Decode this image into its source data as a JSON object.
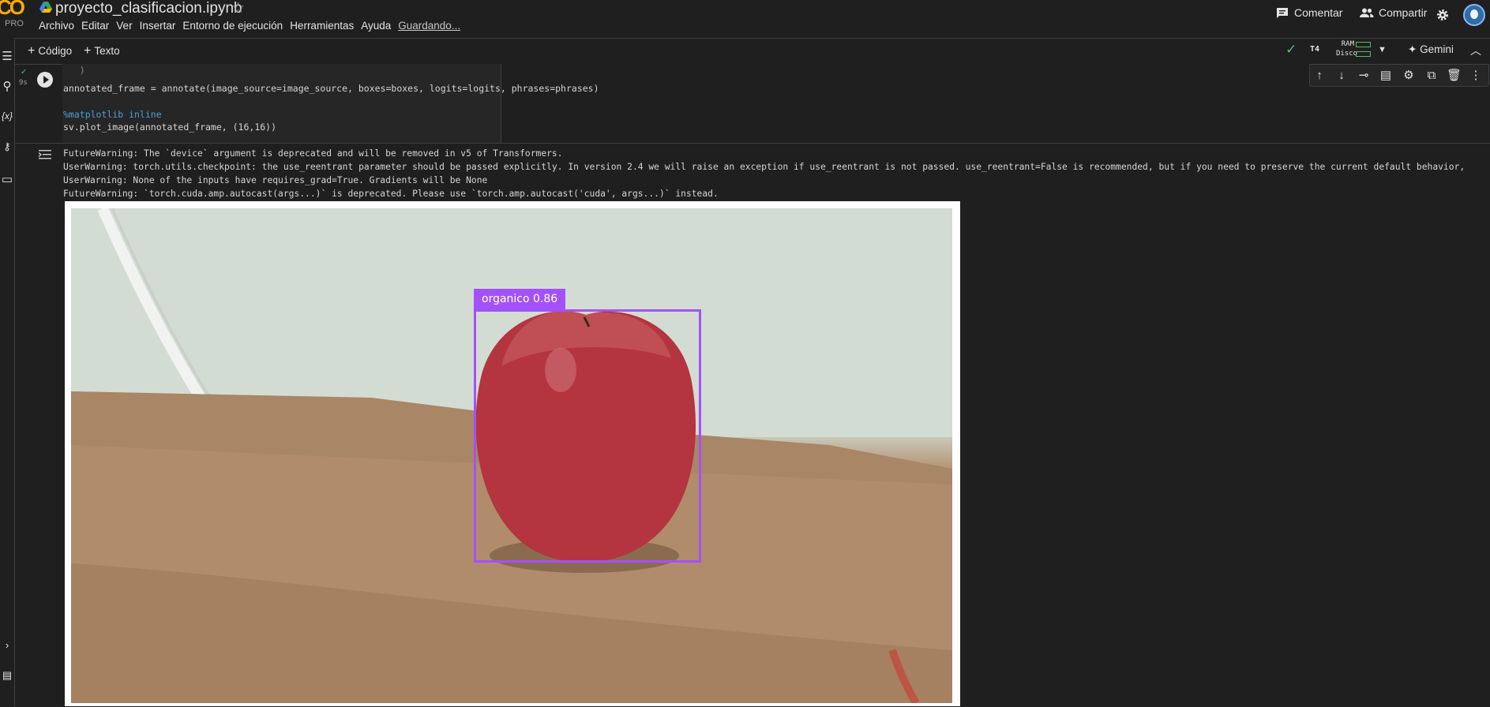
{
  "header": {
    "logo_text": "CO",
    "plan": "PRO",
    "file_name": "proyecto_clasificacion.ipynb",
    "menu": [
      "Archivo",
      "Editar",
      "Ver",
      "Insertar",
      "Entorno de ejecución",
      "Herramientas",
      "Ayuda"
    ],
    "status": "Guardando...",
    "comment_label": "Comentar",
    "share_label": "Compartir"
  },
  "toolbar": {
    "code_label": "Código",
    "text_label": "Texto",
    "runtime_type": "T4",
    "ram_label": "RAM",
    "disk_label": "Disco",
    "gemini_label": "Gemini"
  },
  "cell": {
    "exec_time": "9s",
    "code_lines": [
      "annotated_frame = annotate(image_source=image_source, boxes=boxes, logits=logits, phrases=phrases)",
      "%matplotlib inline",
      "sv.plot_image(annotated_frame, (16,16))"
    ]
  },
  "output": {
    "warnings": [
      "FutureWarning: The `device` argument is deprecated and will be removed in v5 of Transformers.",
      "UserWarning: torch.utils.checkpoint: the use_reentrant parameter should be passed explicitly. In version 2.4 we will raise an exception if use_reentrant is not passed. use_reentrant=False is recommended, but if you need to preserve the current default behavior,",
      "UserWarning: None of the inputs have requires_grad=True. Gradients will be None",
      "FutureWarning: `torch.cuda.amp.autocast(args...)` is deprecated. Please use `torch.amp.autocast('cuda', args...)` instead."
    ],
    "detection": {
      "label": "organico 0.86",
      "box_color": "#a351fb"
    }
  },
  "colors": {
    "background": "#1f1f1f",
    "accent_green": "#5bb974",
    "logo_orange": "#f9ab00"
  }
}
